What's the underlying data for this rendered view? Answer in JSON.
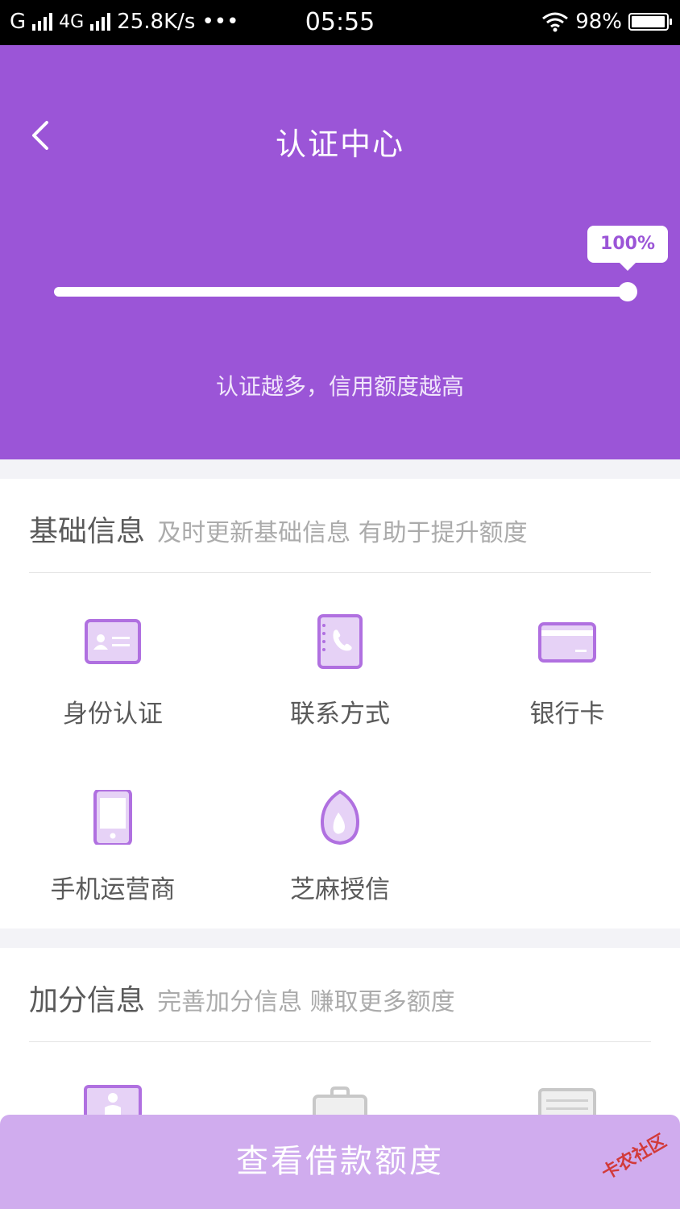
{
  "status_bar": {
    "carrier1": "G",
    "carrier2": "4G",
    "speed": "25.8K/s",
    "more": "•••",
    "time": "05:55",
    "battery": "98%",
    "battery_level": 0.98
  },
  "header": {
    "title": "认证中心",
    "progress_label": "100%",
    "progress": 1.0,
    "tagline": "认证越多，信用额度越高"
  },
  "basic_section": {
    "title": "基础信息",
    "subtitle": "及时更新基础信息 有助于提升额度",
    "items": [
      {
        "label": "身份认证",
        "icon": "id-card-icon"
      },
      {
        "label": "联系方式",
        "icon": "phone-book-icon"
      },
      {
        "label": "银行卡",
        "icon": "bank-card-icon"
      },
      {
        "label": "手机运营商",
        "icon": "mobile-phone-icon"
      },
      {
        "label": "芝麻授信",
        "icon": "sesame-credit-icon"
      }
    ]
  },
  "bonus_section": {
    "title": "加分信息",
    "subtitle": "完善加分信息 赚取更多额度"
  },
  "cta": {
    "label": "查看借款额度"
  },
  "watermark": "卡农社区",
  "colors": {
    "brand": "#9b55d7",
    "cta_bg": "#d0acee",
    "icon": "#b070e0",
    "icon_fill": "#e6d2f6"
  }
}
